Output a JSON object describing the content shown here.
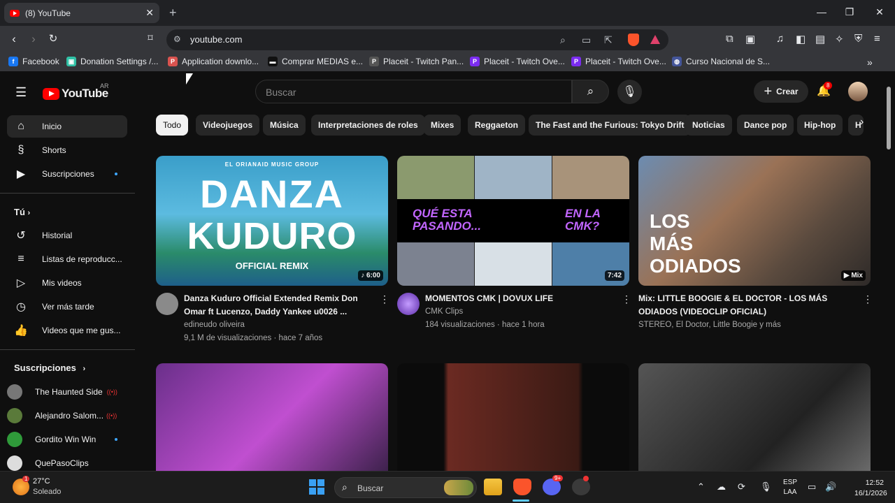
{
  "browser": {
    "tab_title": "(8) YouTube",
    "url": "youtube.com",
    "bookmarks": [
      {
        "label": "Facebook",
        "color": "#1877f2",
        "glyph": "f"
      },
      {
        "label": "Donation Settings /...",
        "color": "#30c1a6",
        "glyph": "▣"
      },
      {
        "label": "Application downlo...",
        "color": "#d9534f",
        "glyph": "P"
      },
      {
        "label": "Comprar MEDIAS e...",
        "color": "#111111",
        "glyph": "▬"
      },
      {
        "label": "Placeit - Twitch Pan...",
        "color": "#555555",
        "glyph": "P"
      },
      {
        "label": "Placeit - Twitch Ove...",
        "color": "#7b2cf0",
        "glyph": "P"
      },
      {
        "label": "Placeit - Twitch Ove...",
        "color": "#7b2cf0",
        "glyph": "P"
      },
      {
        "label": "Curso Nacional de S...",
        "color": "#445599",
        "glyph": "◍"
      }
    ]
  },
  "youtube": {
    "logo_text": "YouTube",
    "country_code": "AR",
    "search_placeholder": "Buscar",
    "create_label": "Crear",
    "notification_count": "8",
    "sidebar": {
      "main": [
        {
          "label": "Inicio",
          "icon": "home-icon"
        },
        {
          "label": "Shorts",
          "icon": "shorts-icon"
        },
        {
          "label": "Suscripciones",
          "icon": "subscriptions-icon"
        }
      ],
      "you_header": "Tú",
      "you": [
        {
          "label": "Historial",
          "icon": "history-icon"
        },
        {
          "label": "Listas de reproducc...",
          "icon": "playlists-icon"
        },
        {
          "label": "Mis videos",
          "icon": "my-videos-icon"
        },
        {
          "label": "Ver más tarde",
          "icon": "watch-later-icon"
        },
        {
          "label": "Videos que me gus...",
          "icon": "liked-icon"
        }
      ],
      "subs_header": "Suscripciones",
      "subs": [
        {
          "label": "The Haunted Side",
          "color": "#777777"
        },
        {
          "label": "Alejandro Salom...",
          "color": "#5a7a3a"
        },
        {
          "label": "Gordito Win Win",
          "color": "#2f9a3a"
        },
        {
          "label": "QuePasoClips",
          "color": "#dddddd"
        }
      ]
    },
    "chips": [
      "Todo",
      "Videojuegos",
      "Música",
      "Interpretaciones de roles",
      "Mixes",
      "Reggaeton",
      "The Fast and the Furious: Tokyo Drift",
      "Noticias",
      "Dance pop",
      "Hip-hop",
      "H"
    ],
    "videos": [
      {
        "title_line1": "Danza Kuduro Official Extended Remix Don",
        "title_line2": "Omar ft Lucenzo, Daddy Yankee u0026 ...",
        "channel": "edineudo oliveira",
        "meta": "9,1 M de visualizaciones · hace 7 años",
        "duration": "♪ 6:00",
        "thumb_text_top": "EL ORIANAID MUSIC GROUP",
        "thumb_text_1": "DANZA",
        "thumb_text_2": "KUDURO",
        "thumb_text_3": "OFFICIAL REMIX"
      },
      {
        "title_line1": "MOMENTOS CMK | DOVUX LIFE",
        "title_line2": "",
        "channel": "CMK Clips",
        "meta": "184 visualizaciones · hace 1 hora",
        "duration": "7:42",
        "thumb_text_1": "QUÉ ESTA PASANDO...",
        "thumb_text_2": "EN LA CMK?"
      },
      {
        "title_line1": "Mix: LITTLE BOOGIE & EL DOCTOR - LOS MÁS",
        "title_line2": "ODIADOS  (VIDEOCLIP OFICIAL)",
        "channel": "STEREO, El Doctor, Little Boogie y más",
        "meta": "",
        "duration": "▶ Mix",
        "thumb_text_1": "LOS",
        "thumb_text_2": "MÁS",
        "thumb_text_3": "ODIADOS"
      }
    ]
  },
  "taskbar": {
    "temperature": "27°C",
    "condition": "Soleado",
    "weather_badge": "1",
    "search_label": "Buscar",
    "lang_line1": "ESP",
    "lang_line2": "LAA",
    "time": "12:52",
    "date": "16/1/2026",
    "discord_badge": "9+"
  }
}
